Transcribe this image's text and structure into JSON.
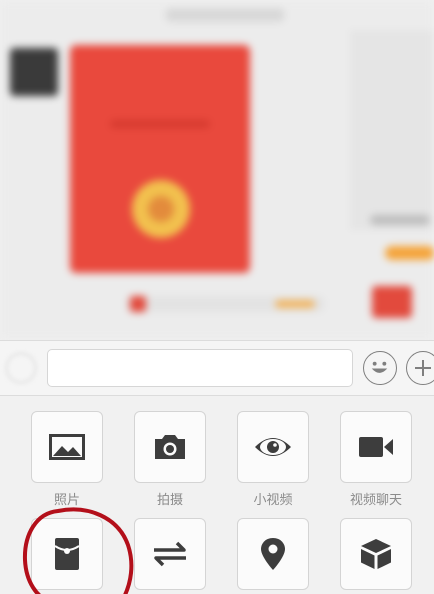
{
  "chat": {},
  "input_bar": {
    "message_value": ""
  },
  "panel": {
    "row1": [
      {
        "label": "照片",
        "icon": "photo-icon"
      },
      {
        "label": "拍摄",
        "icon": "camera-icon"
      },
      {
        "label": "小视频",
        "icon": "eye-icon"
      },
      {
        "label": "视频聊天",
        "icon": "video-call-icon"
      }
    ],
    "row2": [
      {
        "icon": "red-packet-icon"
      },
      {
        "icon": "transfer-icon"
      },
      {
        "icon": "location-icon"
      },
      {
        "icon": "cube-icon"
      }
    ]
  },
  "colors": {
    "icon": "#3d3d3d",
    "label": "#8b8b8b",
    "red_packet": "#e9493d",
    "annotation": "#b30f1a"
  }
}
